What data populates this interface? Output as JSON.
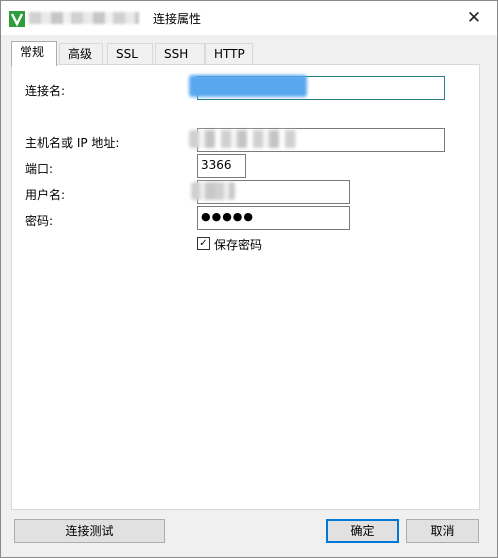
{
  "window": {
    "title": "连接属性",
    "close_glyph": "✕"
  },
  "tabs": [
    {
      "label": "常规",
      "active": true
    },
    {
      "label": "高级",
      "active": false
    },
    {
      "label": "SSL",
      "active": false
    },
    {
      "label": "SSH",
      "active": false
    },
    {
      "label": "HTTP",
      "active": false
    }
  ],
  "form": {
    "connection_name_label": "连接名:",
    "host_label": "主机名或 IP 地址:",
    "port_label": "端口:",
    "port_value": "3366",
    "username_label": "用户名:",
    "password_label": "密码:",
    "password_value": "●●●●●",
    "save_password_label": "保存密码",
    "save_password_checked": true,
    "check_glyph": "✓"
  },
  "buttons": {
    "test": "连接测试",
    "ok": "确定",
    "cancel": "取消"
  },
  "colors": {
    "accent": "#0078d7",
    "redaction_blue": "#58a8f0"
  }
}
